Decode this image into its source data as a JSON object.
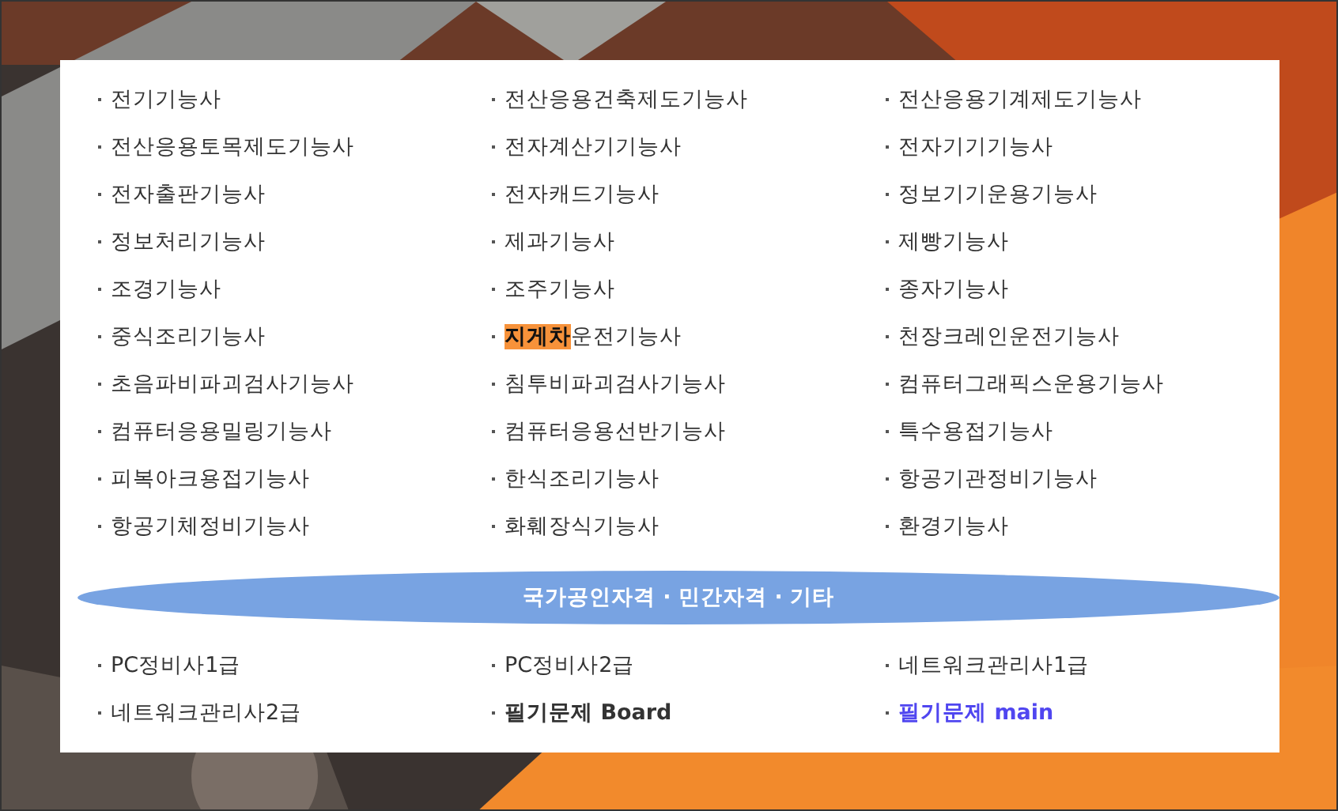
{
  "sections": [
    {
      "items": [
        {
          "text": "전기기능사",
          "kind": "plain"
        },
        {
          "text": "전산응용건축제도기능사",
          "kind": "plain"
        },
        {
          "text": "전산응용기계제도기능사",
          "kind": "plain"
        },
        {
          "text": "전산응용토목제도기능사",
          "kind": "plain"
        },
        {
          "text": "전자계산기기능사",
          "kind": "plain"
        },
        {
          "text": "전자기기기능사",
          "kind": "plain"
        },
        {
          "text": "전자출판기능사",
          "kind": "plain"
        },
        {
          "text": "전자캐드기능사",
          "kind": "plain"
        },
        {
          "text": "정보기기운용기능사",
          "kind": "plain"
        },
        {
          "text": "정보처리기능사",
          "kind": "plain"
        },
        {
          "text": "제과기능사",
          "kind": "plain"
        },
        {
          "text": "제빵기능사",
          "kind": "plain"
        },
        {
          "text": "조경기능사",
          "kind": "plain"
        },
        {
          "text": "조주기능사",
          "kind": "plain"
        },
        {
          "text": "종자기능사",
          "kind": "plain"
        },
        {
          "text": "중식조리기능사",
          "kind": "plain"
        },
        {
          "text": "**지게차**운전기능사",
          "kind": "plain"
        },
        {
          "text": "천장크레인운전기능사",
          "kind": "plain"
        },
        {
          "text": "초음파비파괴검사기능사",
          "kind": "plain"
        },
        {
          "text": "침투비파괴검사기능사",
          "kind": "plain"
        },
        {
          "text": "컴퓨터그래픽스운용기능사",
          "kind": "plain"
        },
        {
          "text": "컴퓨터응용밀링기능사",
          "kind": "plain"
        },
        {
          "text": "컴퓨터응용선반기능사",
          "kind": "plain"
        },
        {
          "text": "특수용접기능사",
          "kind": "plain"
        },
        {
          "text": "피복아크용접기능사",
          "kind": "plain"
        },
        {
          "text": "한식조리기능사",
          "kind": "plain"
        },
        {
          "text": "항공기관정비기능사",
          "kind": "plain"
        },
        {
          "text": "항공기체정비기능사",
          "kind": "plain"
        },
        {
          "text": "화훼장식기능사",
          "kind": "plain"
        },
        {
          "text": "환경기능사",
          "kind": "plain"
        }
      ]
    },
    {
      "heading": "국가공인자격 · 민간자격 · 기타",
      "items": [
        {
          "text": "PC정비사1급",
          "kind": "plain"
        },
        {
          "text": "PC정비사2급",
          "kind": "plain"
        },
        {
          "text": "네트워크관리사1급",
          "kind": "plain"
        },
        {
          "text": "네트워크관리사2급",
          "kind": "plain"
        },
        {
          "text": "필기문제 Board",
          "kind": "bold"
        },
        {
          "text": "필기문제 main",
          "kind": "accent"
        }
      ]
    }
  ]
}
